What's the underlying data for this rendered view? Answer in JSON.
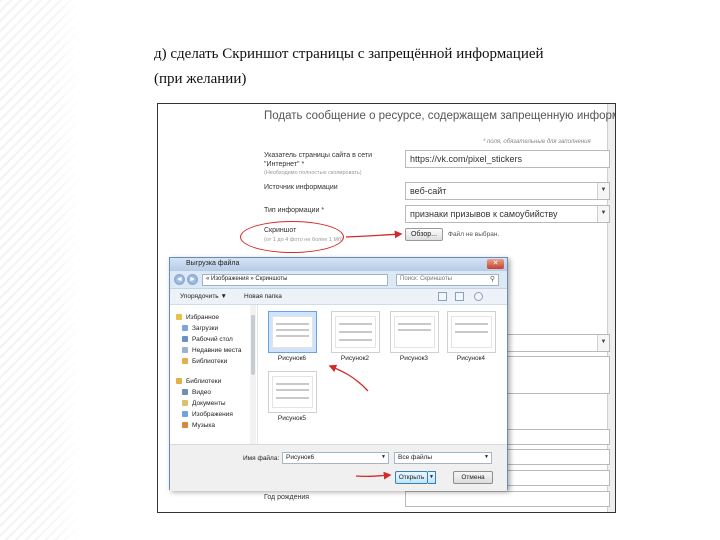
{
  "heading": {
    "line1": "д) сделать Скриншот страницы с запрещённой информацией",
    "line2": "(при  желании)"
  },
  "form": {
    "title": "Подать сообщение о ресурсе, содержащем запрещенную информацию",
    "required_note": "* поля, обязательные для заполнения",
    "url_label": "Указатель страницы сайта в сети \"Интернет\" *",
    "url_hint": "(Необходимо полностью скопировать)",
    "url_value": "https://vk.com/pixel_stickers",
    "source_label": "Источник информации",
    "source_value": "веб-сайт",
    "type_label": "Тип информации *",
    "type_value": "признаки призывов к самоубийству",
    "screenshot_label": "Скриншот",
    "screenshot_hint": "(от 1 до 4 фото не более 1 Мб)",
    "browse_label": "Обзор...",
    "no_file_text": "Файл не выбран.",
    "footer_label": "Год рождения"
  },
  "dialog": {
    "title": "Выгрузка файла",
    "close": "✕",
    "path": "« Изображения » Скриншоты",
    "search_placeholder": "Поиск: Скриншоты",
    "toolbar": {
      "organize": "Упорядочить ▼",
      "new_folder": "Новая папка"
    },
    "favorites": [
      {
        "label": "Избранное",
        "color": "#e8c04a"
      },
      {
        "label": "Загрузки",
        "color": "#7fa6d6"
      },
      {
        "label": "Рабочий стол",
        "color": "#6a90c6"
      },
      {
        "label": "Недавние места",
        "color": "#9cb3cf"
      },
      {
        "label": "Библиотеки",
        "color": "#e0b04a"
      }
    ],
    "libraries": [
      {
        "label": "Видео",
        "color": "#6c8fbc"
      },
      {
        "label": "Документы",
        "color": "#d9c26a"
      },
      {
        "label": "Изображения",
        "color": "#6fa4d8"
      },
      {
        "label": "Музыка",
        "color": "#d48a3a"
      }
    ],
    "files": [
      {
        "label": "Рисунок6",
        "selected": true
      },
      {
        "label": "Рисунок2",
        "selected": false
      },
      {
        "label": "Рисунок3",
        "selected": false
      },
      {
        "label": "Рисунок4",
        "selected": false
      },
      {
        "label": "Рисунок5",
        "selected": false
      }
    ],
    "filename_label": "Имя файла:",
    "filename_value": "Рисунок6",
    "filetype_value": "Все файлы",
    "open_label": "Открыть",
    "cancel_label": "Отмена"
  },
  "colors": {
    "annotation_red": "#d42a2a",
    "dialog_accent": "#6ea4de"
  }
}
